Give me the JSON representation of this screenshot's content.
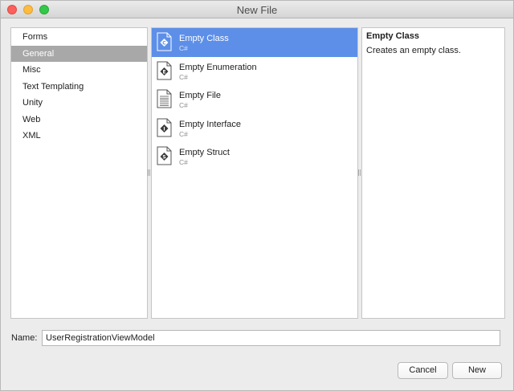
{
  "window": {
    "title": "New File"
  },
  "categories": [
    {
      "label": "Forms",
      "selected": false
    },
    {
      "label": "General",
      "selected": true
    },
    {
      "label": "Misc",
      "selected": false
    },
    {
      "label": "Text Templating",
      "selected": false
    },
    {
      "label": "Unity",
      "selected": false
    },
    {
      "label": "Web",
      "selected": false
    },
    {
      "label": "XML",
      "selected": false
    }
  ],
  "templates": [
    {
      "name": "Empty Class",
      "lang": "C#",
      "icon": "class-file-icon",
      "glyph": "C",
      "selected": true
    },
    {
      "name": "Empty Enumeration",
      "lang": "C#",
      "icon": "enum-file-icon",
      "glyph": "E",
      "selected": false
    },
    {
      "name": "Empty File",
      "lang": "C#",
      "icon": "empty-file-icon",
      "glyph": "",
      "selected": false
    },
    {
      "name": "Empty Interface",
      "lang": "C#",
      "icon": "interface-file-icon",
      "glyph": "I",
      "selected": false
    },
    {
      "name": "Empty Struct",
      "lang": "C#",
      "icon": "struct-file-icon",
      "glyph": "S",
      "selected": false
    }
  ],
  "description": {
    "title": "Empty Class",
    "text": "Creates an empty class."
  },
  "name_field": {
    "label": "Name:",
    "value": "UserRegistrationViewModel"
  },
  "buttons": {
    "cancel": "Cancel",
    "new": "New"
  },
  "colors": {
    "selection_blue": "#5d8fe8",
    "category_selected": "#a8a8a8"
  }
}
